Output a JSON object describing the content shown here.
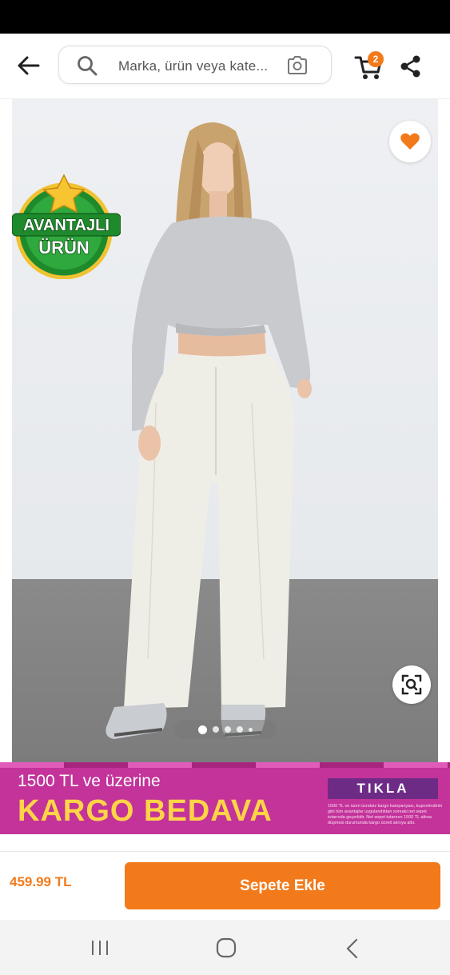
{
  "search": {
    "placeholder": "Marka, ürün veya kate..."
  },
  "cart": {
    "count": "2"
  },
  "badge": {
    "line1": "AVANTAJLI",
    "line2": "ÜRÜN"
  },
  "gallery": {
    "total_images": 5,
    "active_index": 0
  },
  "promo": {
    "line1": "1500 TL ve üzerine",
    "line2": "KARGO BEDAVA",
    "cta": "TIKLA",
    "fine_print": "1500 TL ve üzeri ücretsiz kargo kampanyası, kupon/indirim gibi tüm avantajlar uygulandıktan sonraki net sepet tutarında geçerlidir. Net sepet tutarının 1500 TL altına düşmesi durumunda kargo ücreti alınıya altır."
  },
  "bottom": {
    "price": "459.99 TL",
    "add_to_cart": "Sepete Ekle"
  },
  "colors": {
    "brand_orange": "#f27a1a",
    "promo_pink": "#c3339a",
    "promo_yellow": "#ffd447",
    "badge_green": "#1e8a2c"
  },
  "icons": [
    "back-arrow-icon",
    "search-icon",
    "camera-icon",
    "cart-icon",
    "share-icon",
    "heart-icon",
    "visual-search-icon",
    "recents-icon",
    "home-icon",
    "nav-back-icon"
  ]
}
